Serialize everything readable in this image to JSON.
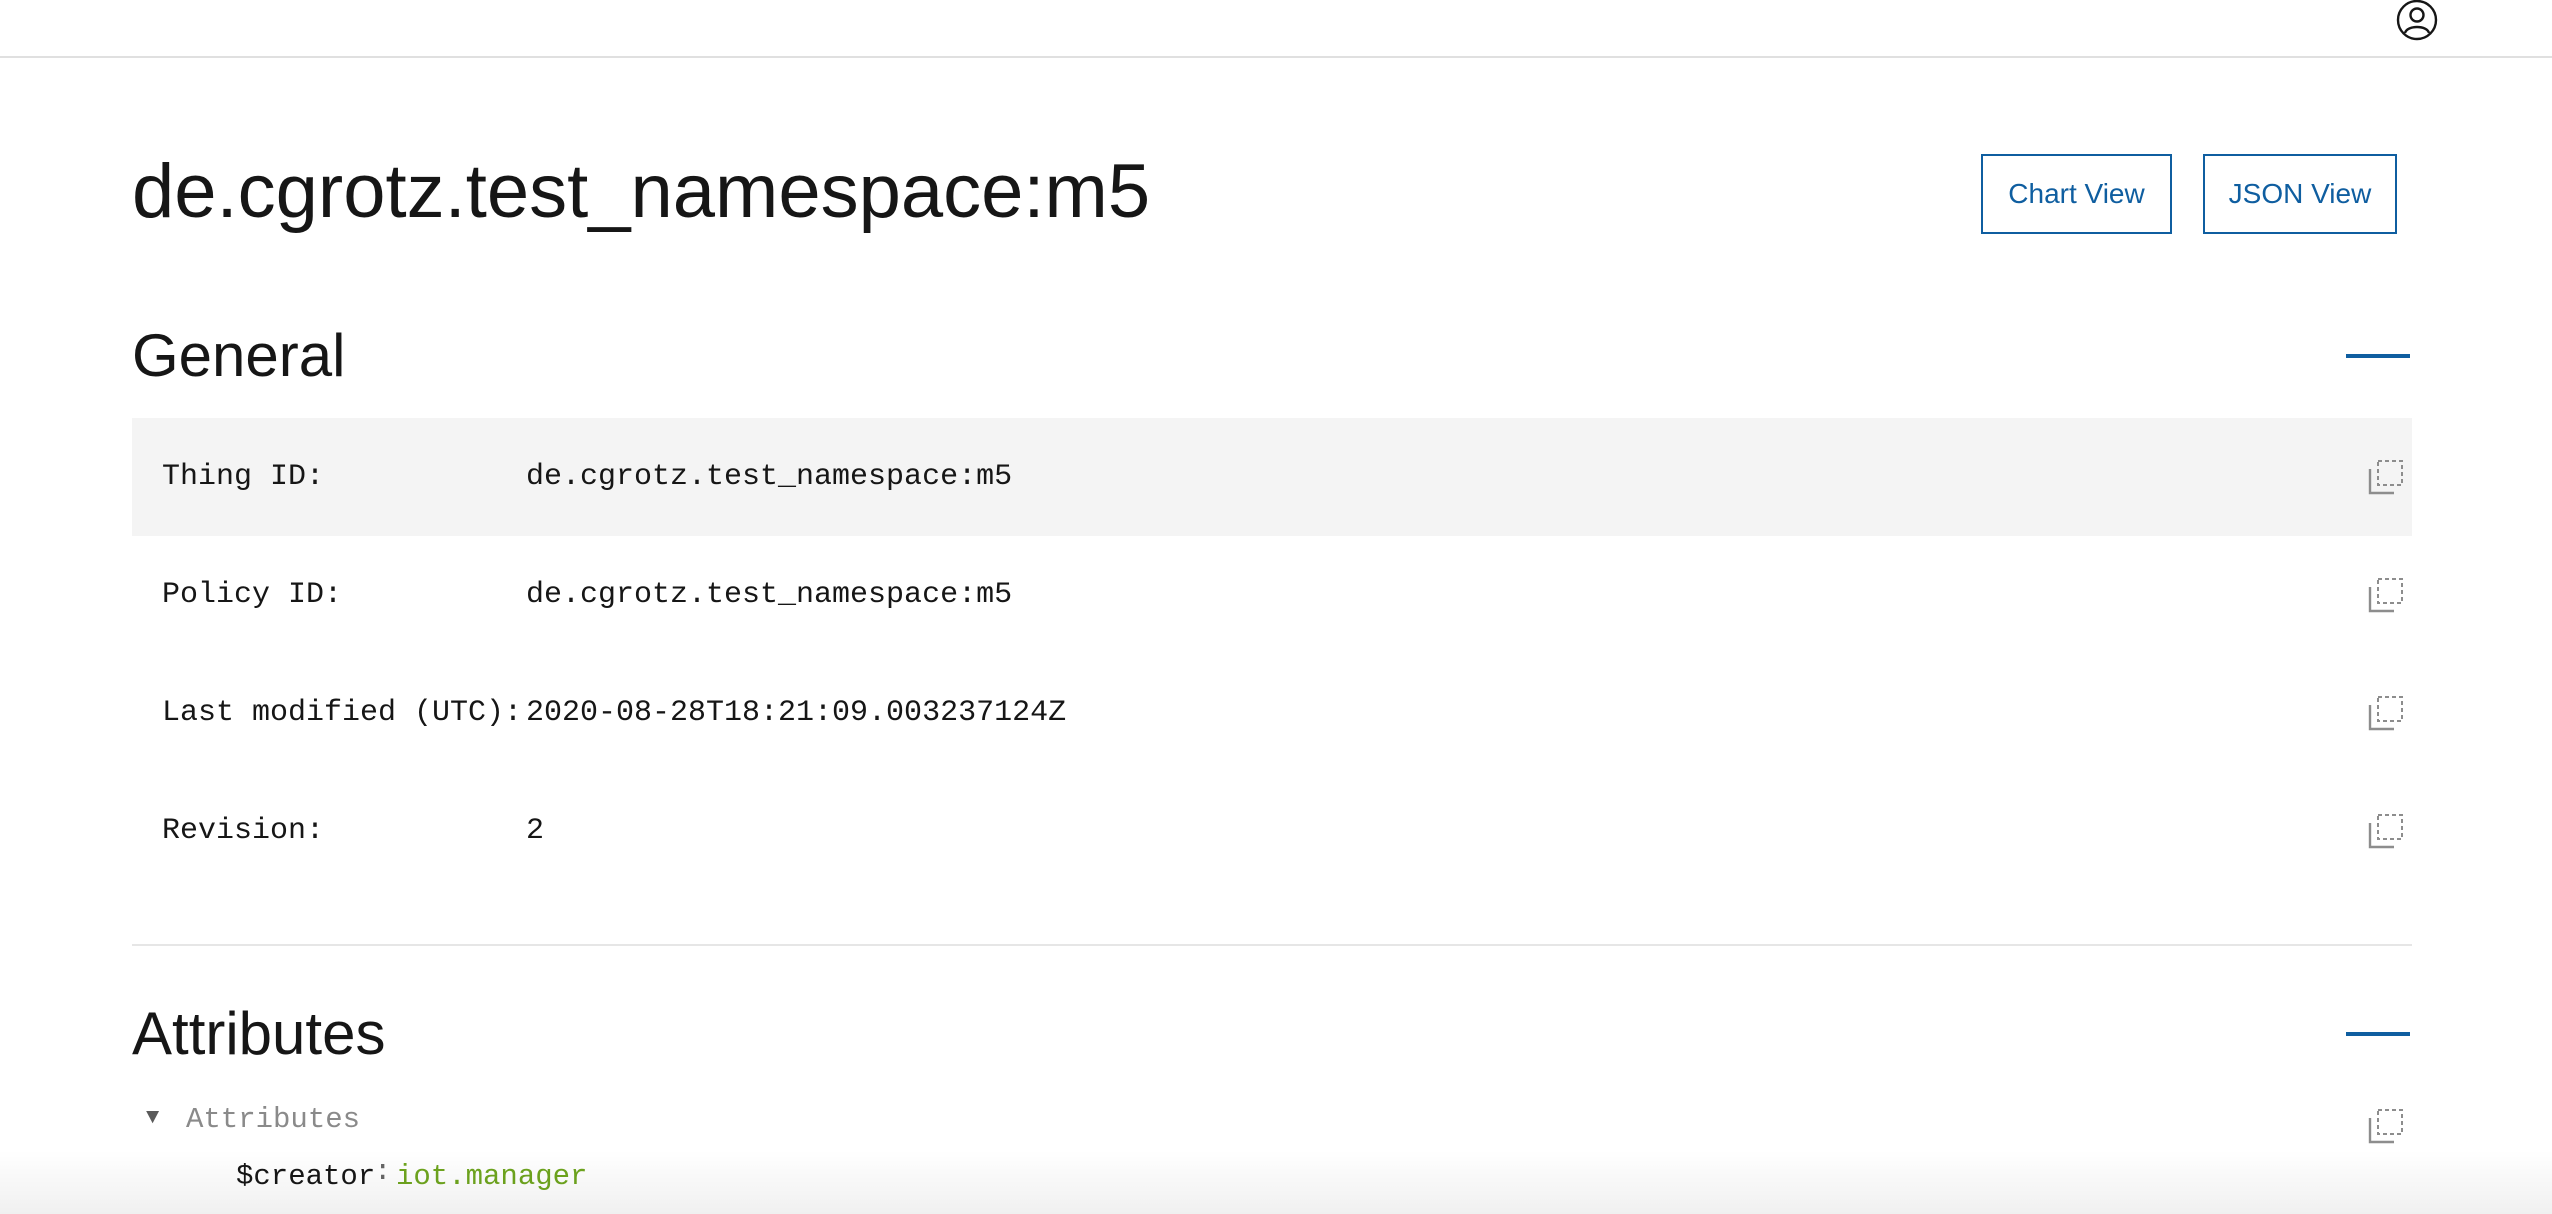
{
  "header": {
    "user_icon": "user-avatar-icon"
  },
  "page": {
    "title": "de.cgrotz.test_namespace:m5",
    "chart_view_label": "Chart View",
    "json_view_label": "JSON View"
  },
  "general": {
    "title": "General",
    "rows": [
      {
        "label": "Thing ID:",
        "value": "de.cgrotz.test_namespace:m5"
      },
      {
        "label": "Policy ID:",
        "value": "de.cgrotz.test_namespace:m5"
      },
      {
        "label": "Last modified (UTC):",
        "value": "2020-08-28T18:21:09.003237124Z"
      },
      {
        "label": "Revision:",
        "value": "2"
      }
    ]
  },
  "attributes": {
    "title": "Attributes",
    "tree_root": "Attributes",
    "entries": [
      {
        "key": "$creator",
        "separator": ":",
        "value": "iot.manager"
      }
    ]
  },
  "colors": {
    "accent": "#0f5ea0",
    "row_shade": "#f4f4f4",
    "json_string": "#6ea51e"
  }
}
